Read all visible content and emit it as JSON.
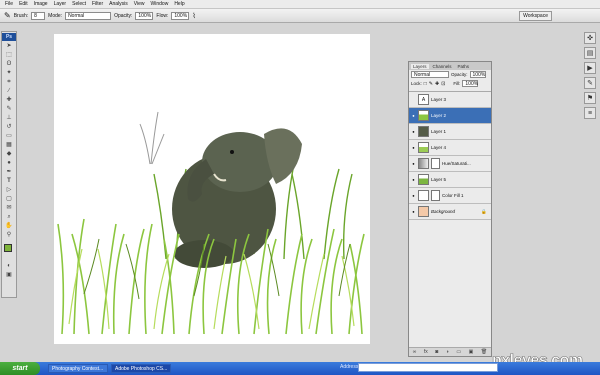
{
  "menu": [
    "File",
    "Edit",
    "Image",
    "Layer",
    "Select",
    "Filter",
    "Analysis",
    "View",
    "Window",
    "Help"
  ],
  "options": {
    "brush_label": "Brush:",
    "brush_size": "8",
    "mode_label": "Mode:",
    "mode_value": "Normal",
    "opacity_label": "Opacity:",
    "opacity_value": "100%",
    "flow_label": "Flow:",
    "flow_value": "100%",
    "workspace_label": "Workspace"
  },
  "toolbox": {
    "logo": "Ps"
  },
  "layers_panel": {
    "tabs": [
      "Layers",
      "Channels",
      "Paths"
    ],
    "blend_mode": "Normal",
    "opacity_label": "Opacity:",
    "opacity_value": "100%",
    "lock_label": "Lock:",
    "fill_label": "Fill:",
    "fill_value": "100%",
    "layers": [
      {
        "name": "Layer 3",
        "visible": false,
        "selected": false
      },
      {
        "name": "Layer 2",
        "visible": true,
        "selected": true
      },
      {
        "name": "Layer 1",
        "visible": true,
        "selected": false
      },
      {
        "name": "Layer 4",
        "visible": true,
        "selected": false
      },
      {
        "name": "Hue/Saturati...",
        "visible": true,
        "selected": false
      },
      {
        "name": "Layer 5",
        "visible": true,
        "selected": false
      },
      {
        "name": "Color Fill 1",
        "visible": true,
        "selected": false
      },
      {
        "name": "Background",
        "visible": true,
        "selected": false
      }
    ]
  },
  "taskbar": {
    "start": "start",
    "items": [
      "Photography Contest...",
      "Adobe Photoshop CS..."
    ],
    "address_label": "Address"
  },
  "watermark": "pxleyes.com",
  "colors": {
    "accent": "#3b6fb6",
    "taskbar": "#245edc",
    "grass": "#8cc63f"
  }
}
